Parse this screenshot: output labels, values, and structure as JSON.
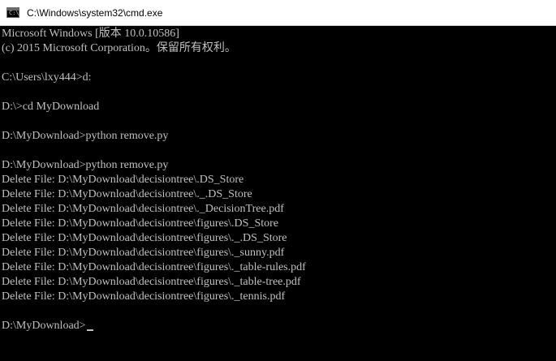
{
  "window": {
    "title": "C:\\Windows\\system32\\cmd.exe",
    "icon": "cmd-icon"
  },
  "icon_glyph": "C:\\",
  "console": {
    "lines": [
      "Microsoft Windows [版本 10.0.10586]",
      "(c) 2015 Microsoft Corporation。保留所有权利。",
      "",
      "C:\\Users\\lxy444>d:",
      "",
      "D:\\>cd MyDownload",
      "",
      "D:\\MyDownload>python remove.py",
      "",
      "D:\\MyDownload>python remove.py",
      "Delete File: D:\\MyDownload\\decisiontree\\.DS_Store",
      "Delete File: D:\\MyDownload\\decisiontree\\._.DS_Store",
      "Delete File: D:\\MyDownload\\decisiontree\\._DecisionTree.pdf",
      "Delete File: D:\\MyDownload\\decisiontree\\figures\\.DS_Store",
      "Delete File: D:\\MyDownload\\decisiontree\\figures\\._.DS_Store",
      "Delete File: D:\\MyDownload\\decisiontree\\figures\\._sunny.pdf",
      "Delete File: D:\\MyDownload\\decisiontree\\figures\\._table-rules.pdf",
      "Delete File: D:\\MyDownload\\decisiontree\\figures\\._table-tree.pdf",
      "Delete File: D:\\MyDownload\\decisiontree\\figures\\._tennis.pdf",
      "",
      "D:\\MyDownload>"
    ]
  },
  "colors": {
    "console_background": "#000000",
    "console_text": "#c0c0c0",
    "titlebar_background": "#ffffff",
    "title_text": "#000000"
  }
}
